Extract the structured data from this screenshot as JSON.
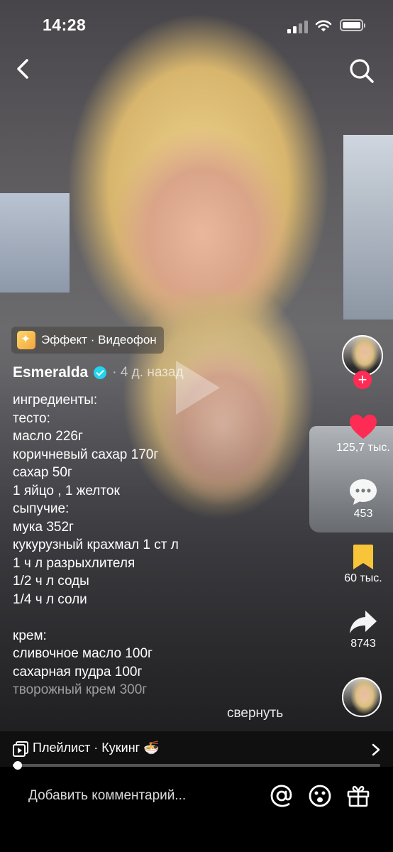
{
  "status_bar": {
    "time": "14:28"
  },
  "effect": {
    "label": "Эффект · Видеофон"
  },
  "author": {
    "name": "Esmeralda",
    "date": "· 4 д. назад"
  },
  "caption_lines": [
    "ингредиенты:",
    "тесто:",
    "масло 226г",
    "коричневый сахар 170г",
    "сахар 50г",
    "1 яйцо , 1 желток",
    "сыпучие:",
    "мука 352г",
    "кукурузный крахмал 1 ст л",
    "1 ч л разрыхлителя",
    "1/2 ч л соды",
    "1/4 ч л соли",
    "",
    "крем:",
    "сливочное масло 100г",
    "сахарная пудра 100г",
    "творожный крем 300г"
  ],
  "collapse_label": "свернуть",
  "actions": {
    "likes": "125,7 тыс.",
    "comments": "453",
    "saves": "60 тыс.",
    "shares": "8743"
  },
  "playlist": {
    "label": "Плейлист · Кукинг 🍜"
  },
  "progress": {
    "fraction": 0.014
  },
  "comment": {
    "placeholder": "Добавить комментарий..."
  },
  "colors": {
    "like": "#fe2c55",
    "save": "#f8c43a",
    "verified": "#20d5ec",
    "follow": "#fe2c55"
  },
  "icons": {
    "back": "chevron-left-icon",
    "search": "search-icon",
    "like": "heart-icon",
    "comment": "speech-bubble-icon",
    "save": "bookmark-icon",
    "share": "share-arrow-icon",
    "mention": "at-icon",
    "emoji": "emoji-icon",
    "gift": "gift-icon"
  }
}
